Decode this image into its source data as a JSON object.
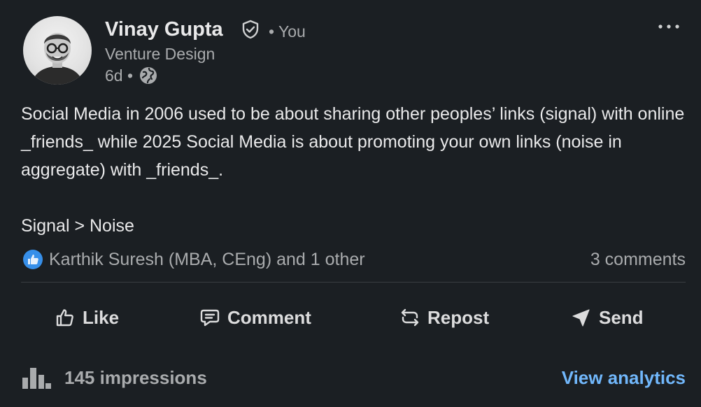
{
  "author": {
    "name": "Vinay Gupta",
    "degree": "• You",
    "headline": "Venture Design",
    "timestamp": "6d •",
    "visibility_icon": "globe-icon",
    "verified_icon": "verified-shield-icon"
  },
  "post": {
    "paragraph_1": "Social Media in 2006 used to be about sharing other peoples’ links (signal) with online _friends_ while 2025 Social Media is about promoting your own links (noise in aggregate) with _friends_.",
    "paragraph_2": "Signal > Noise"
  },
  "social_counts": {
    "reactions_text": "Karthik Suresh (MBA, CEng) and 1 other",
    "comments_text": "3 comments",
    "reaction_icon": "like-badge-icon"
  },
  "actions": {
    "like": "Like",
    "comment": "Comment",
    "repost": "Repost",
    "send": "Send"
  },
  "analytics": {
    "impressions": "145 impressions",
    "view_link": "View analytics"
  },
  "colors": {
    "background": "#1b1f23",
    "text_primary": "#e9e9ea",
    "text_secondary": "#a9abad",
    "link": "#71b7fb",
    "like_badge": "#378fe9"
  }
}
